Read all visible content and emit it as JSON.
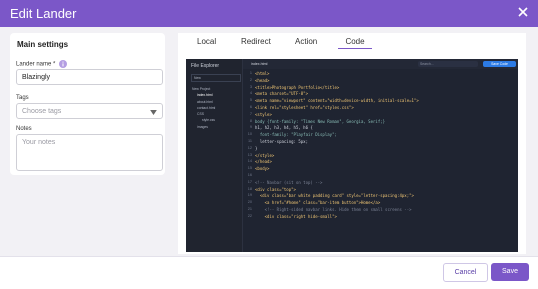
{
  "dialog": {
    "title": "Edit Lander"
  },
  "main_settings": {
    "title": "Main settings",
    "lander_name_label": "Lander name *",
    "lander_name_value": "Blazingly",
    "tags_label": "Tags",
    "tags_placeholder": "Choose tags",
    "notes_label": "Notes",
    "notes_placeholder": "Your notes"
  },
  "tabs": [
    "Local",
    "Redirect",
    "Action",
    "Code"
  ],
  "active_tab": "Code",
  "preview": {
    "file_explorer_title": "File Explorer",
    "new_label": "New",
    "tree": [
      "New Project",
      "index.html",
      "about.html",
      "contact.html",
      "CSS",
      "style.css",
      "images"
    ],
    "open_file": "index.html",
    "search_placeholder": "Search...",
    "save_code_label": "Save Code",
    "lines": [
      "<html>",
      "<head>",
      "<title>Photograph Portfolio</title>",
      "<meta charset=\"UTF-8\">",
      "<meta name=\"viewport\" content=\"width=device-width, initial-scale=1\">",
      "<link rel=\"stylesheet\" href=\"styles.css\">",
      "<style>",
      "body {font-family: \"Times New Roman\", Georgia, Serif;}",
      "h1, h2, h3, h4, h5, h6 {",
      "  font-family: \"Playfair Display\";",
      "  letter-spacing: 5px;",
      "}",
      "</style>",
      "</head>",
      "<body>",
      "",
      "<!-- Navbar (sit on top) -->",
      "<div class=\"top\">",
      "  <div class=\"bar white padding card\" style=\"letter-spacing:4px;\">",
      "    <a href=\"#home\" class=\"bar-item button\">Home</a>",
      "    <!-- Right-sided navbar links. Hide them on small screens -->",
      "    <div class=\"right hide-small\">"
    ]
  },
  "footer": {
    "cancel_label": "Cancel",
    "save_label": "Save"
  },
  "colors": {
    "accent": "#7b57c8",
    "code_bg": "#1f2431",
    "save_code": "#2c7be5"
  }
}
